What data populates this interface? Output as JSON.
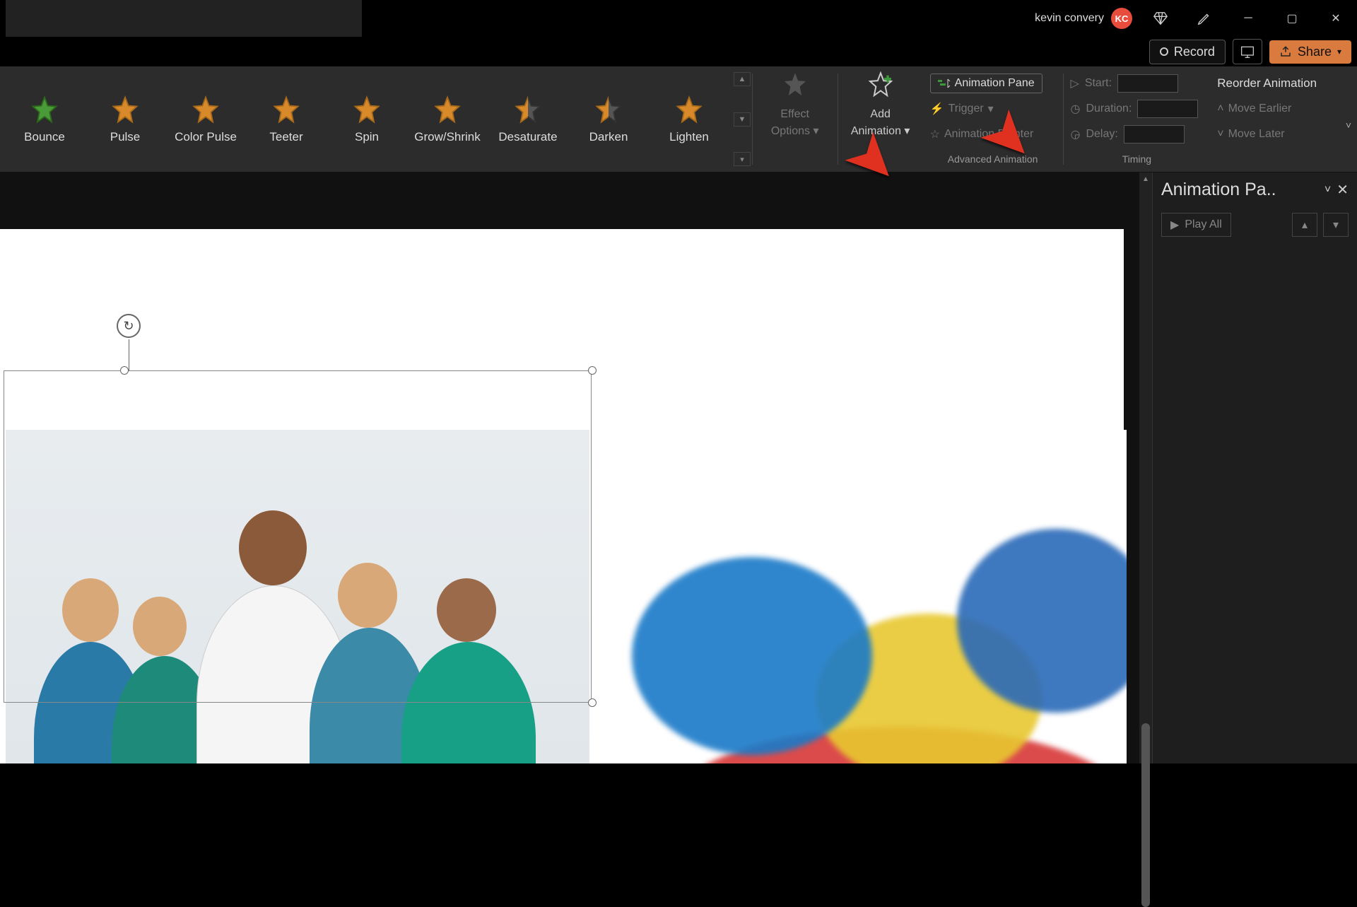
{
  "user": {
    "name": "kevin convery",
    "initials": "KC"
  },
  "row2": {
    "record": "Record",
    "share": "Share"
  },
  "animations": [
    {
      "label": "Bounce",
      "style": "green"
    },
    {
      "label": "Pulse",
      "style": "orange"
    },
    {
      "label": "Color Pulse",
      "style": "orange"
    },
    {
      "label": "Teeter",
      "style": "orange"
    },
    {
      "label": "Spin",
      "style": "orange"
    },
    {
      "label": "Grow/Shrink",
      "style": "orange"
    },
    {
      "label": "Desaturate",
      "style": "orangehalf"
    },
    {
      "label": "Darken",
      "style": "orangehalf"
    },
    {
      "label": "Lighten",
      "style": "orange"
    }
  ],
  "effect": {
    "line1": "Effect",
    "line2": "Options"
  },
  "add": {
    "line1": "Add",
    "line2": "Animation"
  },
  "adv": {
    "pane": "Animation Pane",
    "trigger": "Trigger",
    "painter": "Animation Painter",
    "group": "Advanced Animation"
  },
  "timing": {
    "start": "Start:",
    "duration": "Duration:",
    "delay": "Delay:",
    "reorder": "Reorder Animation",
    "earlier": "Move Earlier",
    "later": "Move Later",
    "group": "Timing",
    "start_val": "",
    "duration_val": "",
    "delay_val": ""
  },
  "panel": {
    "title": "Animation Pa..",
    "play": "Play All"
  }
}
